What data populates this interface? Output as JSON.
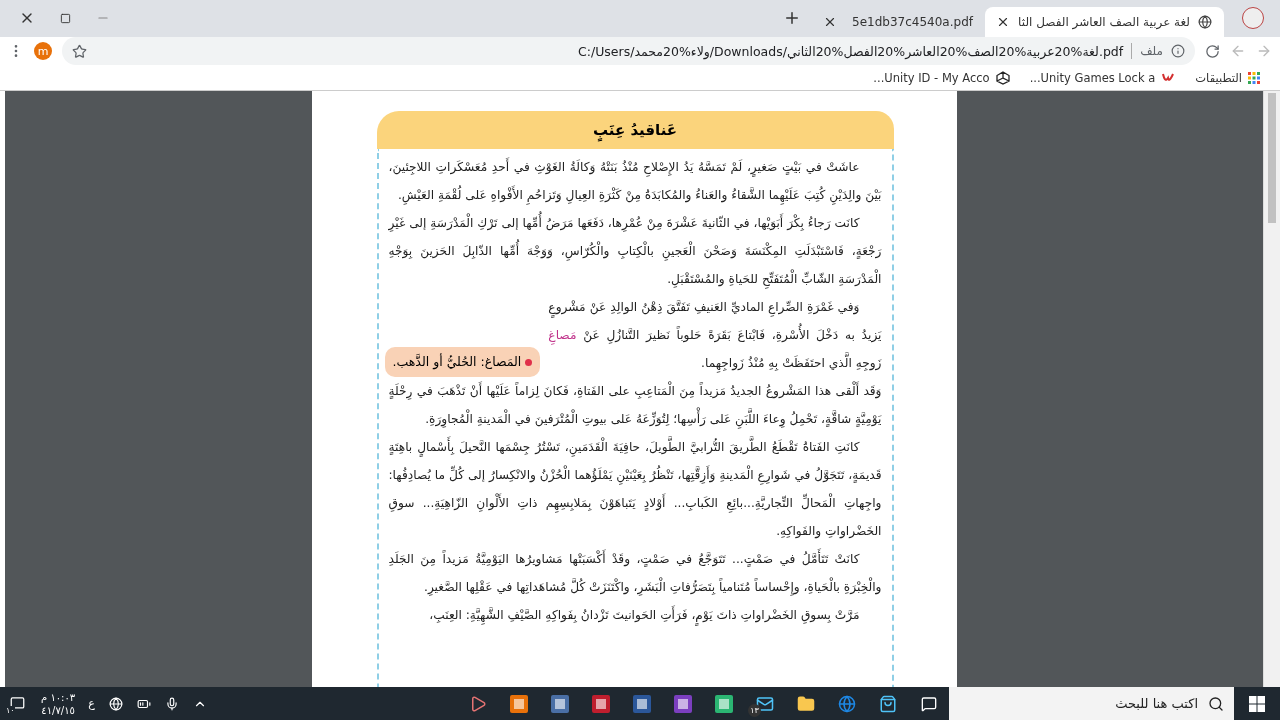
{
  "tabs": [
    {
      "title": "لغة عربية الصف العاشر الفصل الثا",
      "selected": true,
      "kind": "web"
    },
    {
      "title": "5e1db37c4540a.pdf",
      "selected": false,
      "kind": "pdf"
    }
  ],
  "address_bar": {
    "scheme_label": "ملف",
    "url": "C:/Users/ولاء%20محمد/Downloads/لغة%20عربية%20الصف%20العاشر%20الفصل%20الثاني.pdf"
  },
  "avatar": "m",
  "bookmarks": [
    {
      "label": "التطبيقات",
      "kind": "apps"
    },
    {
      "label": "Unity Games Lock a...",
      "kind": "letter"
    },
    {
      "label": "Unity ID - My Acco...",
      "kind": "unity"
    }
  ],
  "document": {
    "title": "عَناقيدُ عِنَبٍ",
    "paragraphs": [
      {
        "parts": [
          {
            "kind": "plain",
            "text": "عاشَتْ في بَيْتٍ صَغيرٍ، لَمْ تَمَسَّهُ يَدُ الإِصْلاحِ مُنْذُ بَنَتْهُ وَكالَةُ الغَوْثِ في أَحدِ مُعَسْكَراتِ اللاجِئينَ، بَيْنَ والِدَيْنِ كُتِبَ عَلَيْهِما الشَّقاءُ والعَناءُ والمُكابَدَةُ مِنْ كَثْرَةِ العِيالِ وَتَزاحُمِ الأَفْواهِ عَلى لُقْمَةِ العَيْشِ."
          }
        ]
      },
      {
        "parts": [
          {
            "kind": "plain",
            "text": "كانَت رَجاءُ بِكْرَ أَبَوَيْها، في الثّانيةَ عَشْرَةَ مِنْ عُمْرِها، دَفَعَها مَرَضُ أُمِّها إلى تَرْكِ الْمَدْرَسَةِ إلى غَيْرِ رَجْعَةٍ، فَاسْتَبْدَلَتِ المِكْنَسَةَ وَصَحْنَ الْعَجينِ بالْكِتابِ والْكُرّاسِ، وَوَجْهَ أُمِّها الذّابِلَ الحَزينَ بِوَجْهِ الْمَدْرَسَةِ الشّابِّ الْمُتَفَتِّحِ للحَياةِ والمُسْتَقْبَلِ."
          }
        ]
      },
      {
        "gloss": "المَصاغ: الحُليُّ أو الذَّهب.",
        "parts": [
          {
            "kind": "plain",
            "text": "وَفي غَمْرَةِ الصِّراعِ الماديِّ العَنيفِ تَفَتَّقَ ذِهْنُ الوالِدِ عَنْ مَشْروعٍ يَزيدُ به دَخْلَ الأُسْرةِ، فَابْتاعَ بَقَرَةً حَلوباً نَظيرَ التَّنازُلِ عَنْ "
          },
          {
            "kind": "glossed",
            "text": "مَصاغِ"
          },
          {
            "kind": "plain",
            "text": " زَوجِهِ الَّذي احتَفَظَتْ بِهِ مُنْذُ زَواجِهِما."
          }
        ]
      },
      {
        "continued": true,
        "parts": [
          {
            "kind": "plain",
            "text": "وَقَد أَلْقى هذا المَشْروعُ الجديدُ مَزيداً مِنَ الْمَتاعِبِ على الفَتاةِ، فَكانَ لِزاماً عَلَيْها أَنْ تَذْهَبَ في رِحْلَةٍ يَوْمِيَّةٍ شاقَّةٍ، تَحْمِلُ وِعاءَ اللَّبَنِ عَلى رَأْسِها؛ لِتُوَزِّعَهُ عَلى بيوتِ الْمُتْرَفينَ في الْمَدينةِ الْمُجاوِرَةِ."
          }
        ]
      },
      {
        "parts": [
          {
            "kind": "plain",
            "text": "كانَتِ الفَتاةُ تَقْطَعُ الطَّريقَ التُّرابيَّ الطَّويلَ، حافِيَةَ الْقَدَمَينِ، تَسْتُرُ جِسْمَها النَّحيلَ بِأَسْمالٍ باهِتَةٍ قَديمَةٍ، تَتَجَوَّلُ في شَوارِعِ الْمَدينةِ وَأَزِقَّتِها، تَنْظُرُ بِعَيْنَيْنِ يَمْلَؤُهما الْحُزْنُ والانْكِسارُ إلى كُلِّ ما يُصادِفُها: واجِهاتِ الْمَحالِّ التِّجاريَّةِ...بائِعِ الكَبابِ... أَوْلادٍ يَتَباهَوْنَ بِمَلابِسِهِم ذاتِ الأَلْوانِ الزّاهِيَةِ... سوقِ الخَضْراواتِ والفَواكِهِ."
          }
        ]
      },
      {
        "parts": [
          {
            "kind": "plain",
            "text": "كانَتْ تَتَأَمَّلُ في صَمْتٍ... تَتَوَجَّعُ في صَمْتٍ، وقَدْ أَكْسَبَتْها مَشاويرُها اليَوْمِيَّةُ مَزيداً مِنَ الجَلَدِ والْخِبْرَةِ بالْحَياةِ، وإِحْساساً مُتَنامياً بِتَصَرُّفاتِ الْبَشَرِ، واكْتَنَزَتْ كُلَّ مُشاهَداتِها في عَقْلِها الصَّغيرِ."
          }
        ]
      },
      {
        "parts": [
          {
            "kind": "plain",
            "text": "مَرَّتْ بِسوقِ الخَضْراواتِ ذاتَ يَوْمٍ، فَرَأَتِ الحَوانيتَ تَزْدانُ بِفَواكِهِ الصَّيْفِ الشَّهِيَّةِ: العِنَبِ،"
          }
        ]
      }
    ]
  },
  "taskbar": {
    "search_placeholder": "اكتب هنا للبحث",
    "mail_badge": "١٣",
    "language": "ع",
    "time": "١٠:٠٣ م",
    "date": "٤١/٧/١٥",
    "notification_count": "١٠"
  }
}
